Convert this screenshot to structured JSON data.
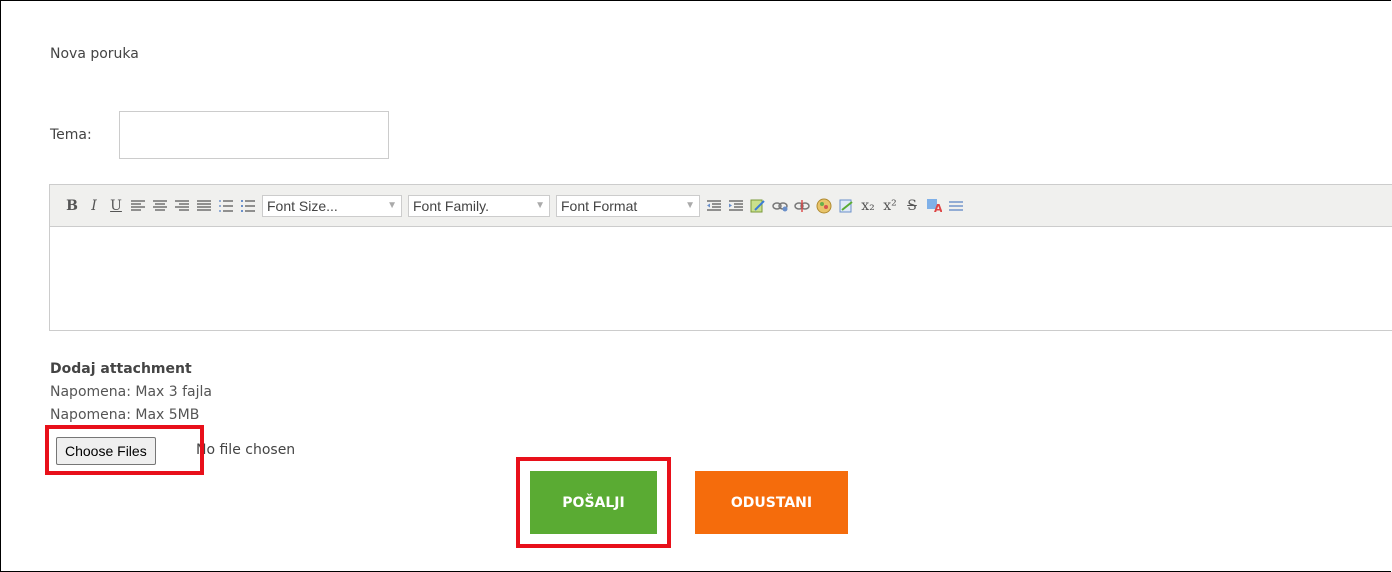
{
  "form": {
    "title": "Nova poruka",
    "subject_label": "Tema:",
    "subject_value": "",
    "subject_placeholder": ""
  },
  "editor": {
    "buttons": {
      "bold": "B",
      "italic": "I",
      "underline": "U",
      "align_left": "≡",
      "align_center": "≡",
      "align_right": "≡",
      "align_justify": "≡",
      "ordered_list": "⋮☰",
      "unordered_list": "⋮☰",
      "outdent": "⇤",
      "indent": "⇥",
      "subscript": "x₂",
      "superscript": "x²",
      "strikethrough": "S"
    },
    "font_size_select": "Font Size...",
    "font_family_select": "Font Family.",
    "font_format_select": "Font Format",
    "content": ""
  },
  "attachment": {
    "title": "Dodaj attachment",
    "note_files": "Napomena: Max 3 fajla",
    "note_size": "Napomena: Max 5MB",
    "choose_label": "Choose Files",
    "no_file_text": "No file chosen"
  },
  "actions": {
    "send_label": "POŠALJI",
    "cancel_label": "ODUSTANI"
  },
  "colors": {
    "send": "#5aab33",
    "cancel": "#f56c0c",
    "highlight": "#e8101a"
  }
}
